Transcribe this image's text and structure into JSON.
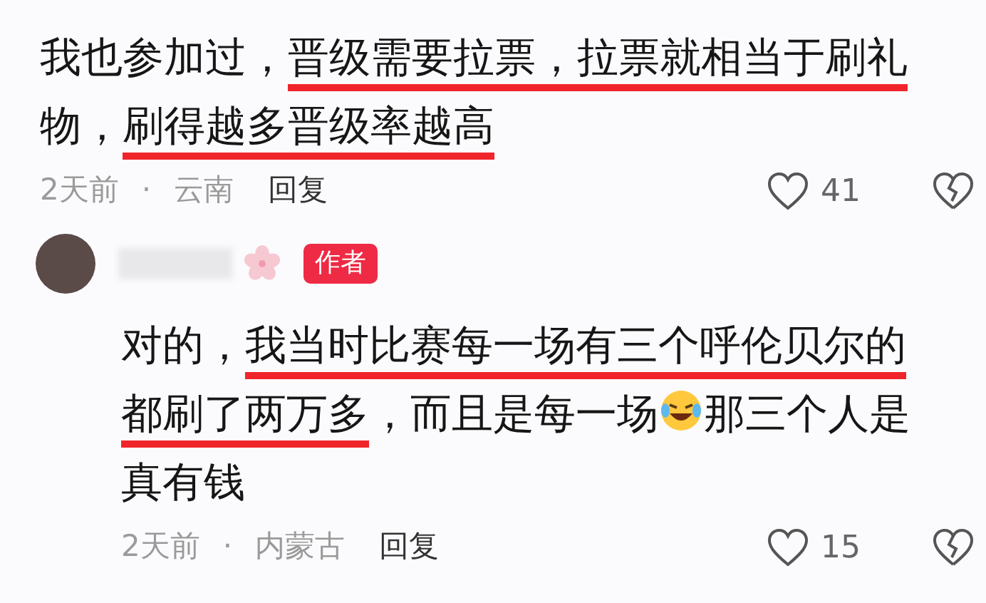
{
  "comments": [
    {
      "kind": "comment",
      "lines": [
        [
          {
            "kind": "text",
            "text": "我也参加过，",
            "underlined": false
          },
          {
            "kind": "text",
            "text": "晋级需要拉票，拉票就相当于刷礼",
            "underlined": true
          }
        ],
        [
          {
            "kind": "text",
            "text": "物，",
            "underlined": false
          },
          {
            "kind": "text",
            "text": "刷得越多晋级率越高",
            "underlined": true
          }
        ]
      ],
      "time": "2天前",
      "separator": "·",
      "location": "云南",
      "reply": "回复",
      "likes": "41"
    },
    {
      "kind": "reply",
      "author_badge": "作者",
      "lines": [
        [
          {
            "kind": "text",
            "text": "对的，",
            "underlined": false
          },
          {
            "kind": "text",
            "text": "我当时比赛每一场有三个呼伦贝尔的",
            "underlined": true
          }
        ],
        [
          {
            "kind": "text",
            "text": "都刷了两万多",
            "underlined": true
          },
          {
            "kind": "text",
            "text": "，而且是每一场",
            "underlined": false
          },
          {
            "kind": "emoji"
          },
          {
            "kind": "text",
            "text": "那三个人是",
            "underlined": false
          }
        ],
        [
          {
            "kind": "text",
            "text": "真有钱",
            "underlined": false
          }
        ]
      ],
      "time": "2天前",
      "separator": "·",
      "location": "内蒙古",
      "reply": "回复",
      "likes": "15"
    }
  ]
}
